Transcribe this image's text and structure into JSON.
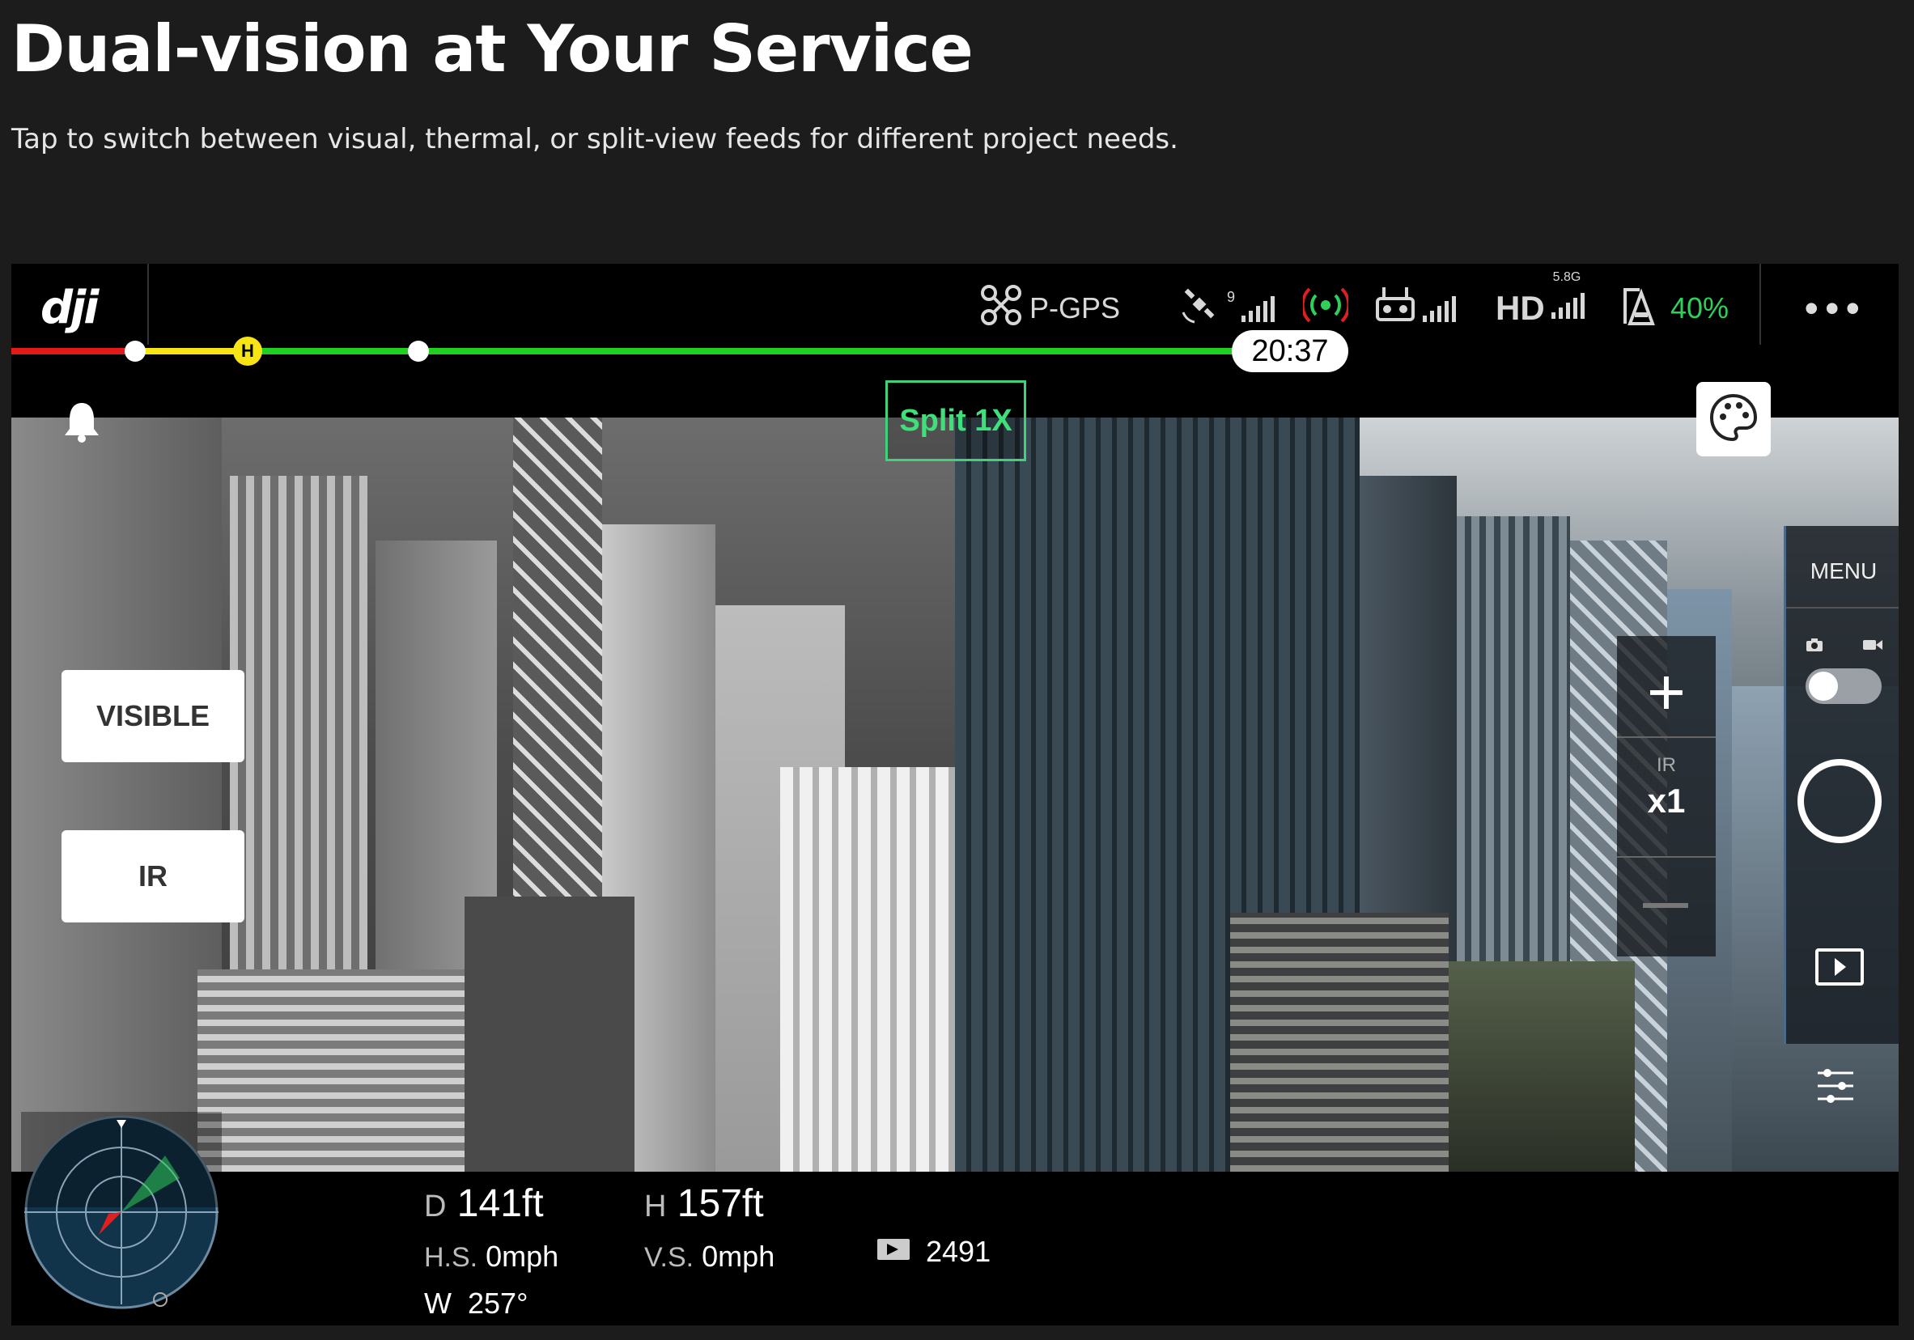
{
  "page": {
    "headline": "Dual-vision at Your Service",
    "subline": "Tap to switch between visual, thermal, or split-view feeds for different project needs."
  },
  "topbar": {
    "logo": "dji",
    "flight_mode": "P-GPS",
    "gps_satellites": "9",
    "transmission": "HD",
    "band": "5.8G",
    "battery": "40%",
    "more": "•••",
    "flight_time": "20:37",
    "home_marker": "H"
  },
  "view": {
    "mode_badge": "Split 1X",
    "visible_button": "VISIBLE",
    "ir_button": "IR",
    "zoom_plus": "+",
    "zoom_source": "IR",
    "zoom_value": "x1"
  },
  "right_panel": {
    "menu": "MENU"
  },
  "telemetry": {
    "distance_prefix": "D",
    "distance": "141ft",
    "height_prefix": "H",
    "height": "157ft",
    "hs_label": "H.S.",
    "hs_value": "0mph",
    "vs_label": "V.S.",
    "vs_value": "0mph",
    "heading_label": "W",
    "heading_value": "257°",
    "photo_count": "2491"
  },
  "colors": {
    "accent_green": "#3fd27a",
    "line_red": "#e21a1a",
    "line_yellow": "#f6e415",
    "line_green": "#20d020"
  },
  "icons": [
    "drone-icon",
    "satellite-icon",
    "signal-icon",
    "remote-controller-icon",
    "battery-icon",
    "bell-icon",
    "palette-icon",
    "camera-icon",
    "video-icon",
    "playback-icon",
    "settings-sliders-icon",
    "radar-icon",
    "photo-count-icon"
  ]
}
